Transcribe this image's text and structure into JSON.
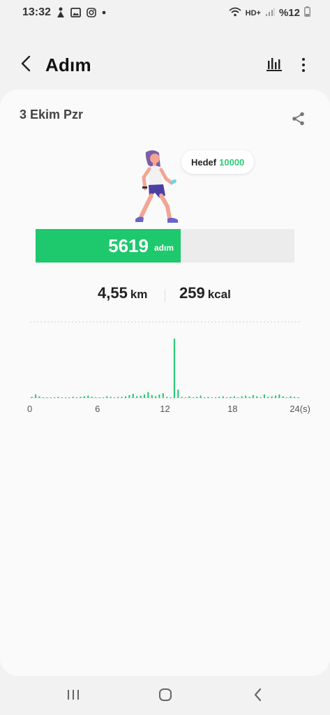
{
  "status_bar": {
    "time": "13:32",
    "network": "HD+",
    "battery": "%12",
    "left_icons": [
      "notification-icon",
      "image-icon",
      "instagram-icon",
      "dot-icon"
    ],
    "right_icons": [
      "wifi-icon",
      "signal-icon",
      "battery-icon"
    ]
  },
  "header": {
    "title": "Adım",
    "icons": [
      "back-arrow-icon",
      "bar-chart-icon",
      "more-vertical-icon"
    ]
  },
  "summary": {
    "date": "3 Ekim Pzr",
    "goal_label": "Hedef",
    "goal_value": "10000",
    "steps": "5619",
    "steps_unit": "adım",
    "progress_fraction": 0.5619,
    "distance_value": "4,55",
    "distance_unit": "km",
    "calories_value": "259",
    "calories_unit": "kcal"
  },
  "colors": {
    "accent": "#1ec86d",
    "goal_text": "#2ecb77",
    "track": "#ececec"
  },
  "chart_data": {
    "type": "bar",
    "x_unit": "(s)",
    "xlim": [
      0,
      24
    ],
    "xticks": [
      "0",
      "6",
      "12",
      "18",
      "24(s)"
    ],
    "hourly_values": [
      2,
      6,
      3,
      1,
      1,
      1,
      1,
      2,
      1,
      1,
      1,
      2,
      1,
      2,
      3,
      4,
      2,
      1,
      1,
      1,
      3,
      2,
      1,
      2,
      2,
      3,
      5,
      7,
      3,
      4,
      6,
      10,
      5,
      3,
      6,
      8,
      2,
      1,
      100,
      14,
      2,
      1,
      3,
      1,
      2,
      4,
      1,
      2,
      1,
      1,
      2,
      3,
      1,
      2,
      3,
      1,
      3,
      4,
      2,
      5,
      3,
      1,
      6,
      2,
      3,
      4,
      6,
      3,
      1,
      3,
      2,
      1
    ]
  },
  "nav": {
    "icons": [
      "recent-apps-icon",
      "home-icon",
      "back-icon"
    ]
  }
}
